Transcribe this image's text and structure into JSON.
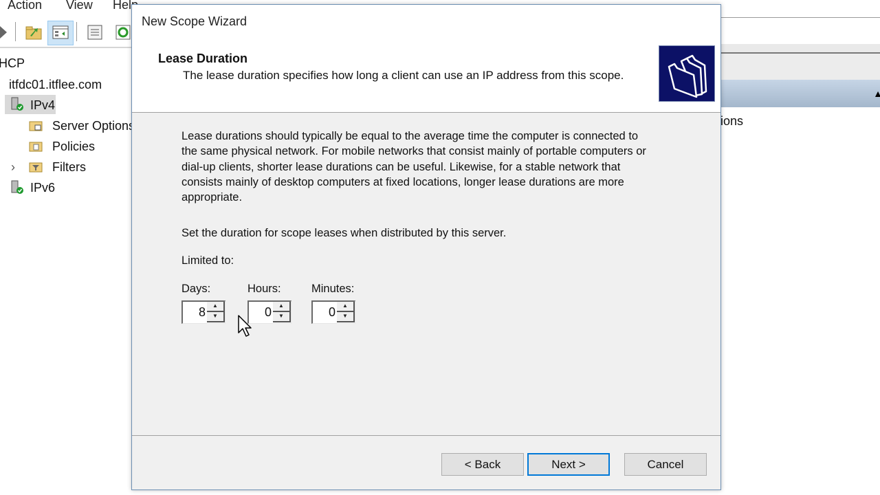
{
  "background_app": {
    "menu": [
      "Action",
      "View",
      "Help"
    ],
    "tree": {
      "root": "DHCP",
      "server": "itfdc01.itflee.com",
      "items": [
        {
          "label": "IPv4",
          "icon": "server-check-icon",
          "selected": true
        },
        {
          "label": "Server Options",
          "icon": "folder-options-icon"
        },
        {
          "label": "Policies",
          "icon": "folder-policies-icon"
        },
        {
          "label": "Filters",
          "icon": "folder-filter-icon",
          "expandable": true
        },
        {
          "label": "IPv6",
          "icon": "server-check-icon"
        }
      ]
    },
    "right_pane": {
      "header_partial": "ions"
    }
  },
  "dialog": {
    "title": "New Scope Wizard",
    "heading": "Lease Duration",
    "subheading": "The lease duration specifies how long a client can use an IP address from this scope.",
    "description": "Lease durations should typically be equal to the average time the computer is connected to the same physical network. For mobile networks that consist mainly of portable computers or dial-up clients, shorter lease durations can be useful. Likewise, for a stable network that consists mainly of desktop computers at fixed locations, longer lease durations are more appropriate.",
    "instruction": "Set the duration for scope leases when distributed by this server.",
    "limited_label": "Limited to:",
    "fields": {
      "days": {
        "label": "Days:",
        "value": "8"
      },
      "hours": {
        "label": "Hours:",
        "value": "0"
      },
      "minutes": {
        "label": "Minutes:",
        "value": "0"
      }
    },
    "buttons": {
      "back": "< Back",
      "next": "Next >",
      "cancel": "Cancel"
    },
    "colors": {
      "icon_bg": "#0c1166",
      "default_button_border": "#0078d7"
    }
  }
}
